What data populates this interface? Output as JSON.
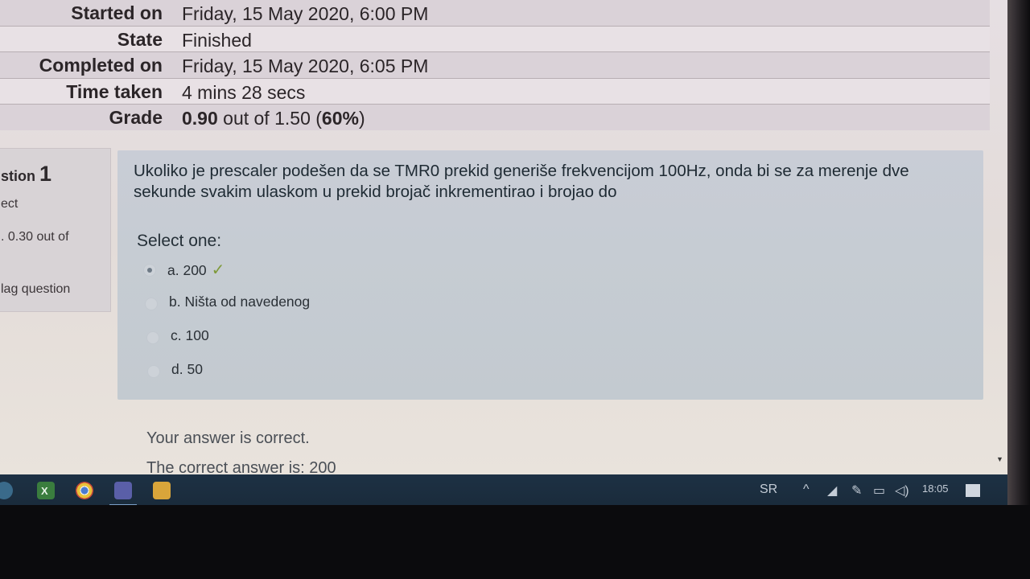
{
  "summary": [
    {
      "label": "Started on",
      "value": "Friday, 15 May 2020, 6:00 PM"
    },
    {
      "label": "State",
      "value": "Finished"
    },
    {
      "label": "Completed on",
      "value": "Friday, 15 May 2020, 6:05 PM"
    },
    {
      "label": "Time taken",
      "value": "4 mins 28 secs"
    },
    {
      "label": "Grade",
      "value_bold": "0.90",
      "value_mid": " out of 1.50 (",
      "value_pct": "60%",
      "value_end": ")"
    }
  ],
  "question_info": {
    "number_label": "stion",
    "number": "1",
    "state": "ect",
    "grade": ". 0.30 out of",
    "flag": "lag question"
  },
  "question": {
    "text": "Ukoliko je prescaler podešen da se TMR0 prekid generiše frekvencijom 100Hz, onda bi se za merenje dve sekunde svakim ulaskom u prekid brojač inkrementirao i brojao do",
    "prompt": "Select one:",
    "options": [
      {
        "label": "a. 200",
        "selected": true,
        "correct": true
      },
      {
        "label": "b. Ništa od navedenog",
        "selected": false
      },
      {
        "label": "c. 100",
        "selected": false
      },
      {
        "label": "d. 50",
        "selected": false
      }
    ],
    "check_icon": "check-icon"
  },
  "feedback": {
    "result": "Your answer is correct.",
    "correct_answer": "The correct answer is: 200"
  },
  "taskbar": {
    "language": "SR",
    "clock": "18:05",
    "icons": [
      "start-icon",
      "excel-icon",
      "chrome-icon",
      "teams-icon",
      "file-explorer-icon"
    ],
    "tray_icons": [
      "chevron-up-icon",
      "wifi-icon",
      "pen-icon",
      "battery-icon",
      "volume-icon",
      "notification-icon"
    ]
  },
  "colors": {
    "accent_check": "#7f9a3a",
    "taskbar": "#1d3144",
    "question_bg": "#c6ccd3"
  }
}
